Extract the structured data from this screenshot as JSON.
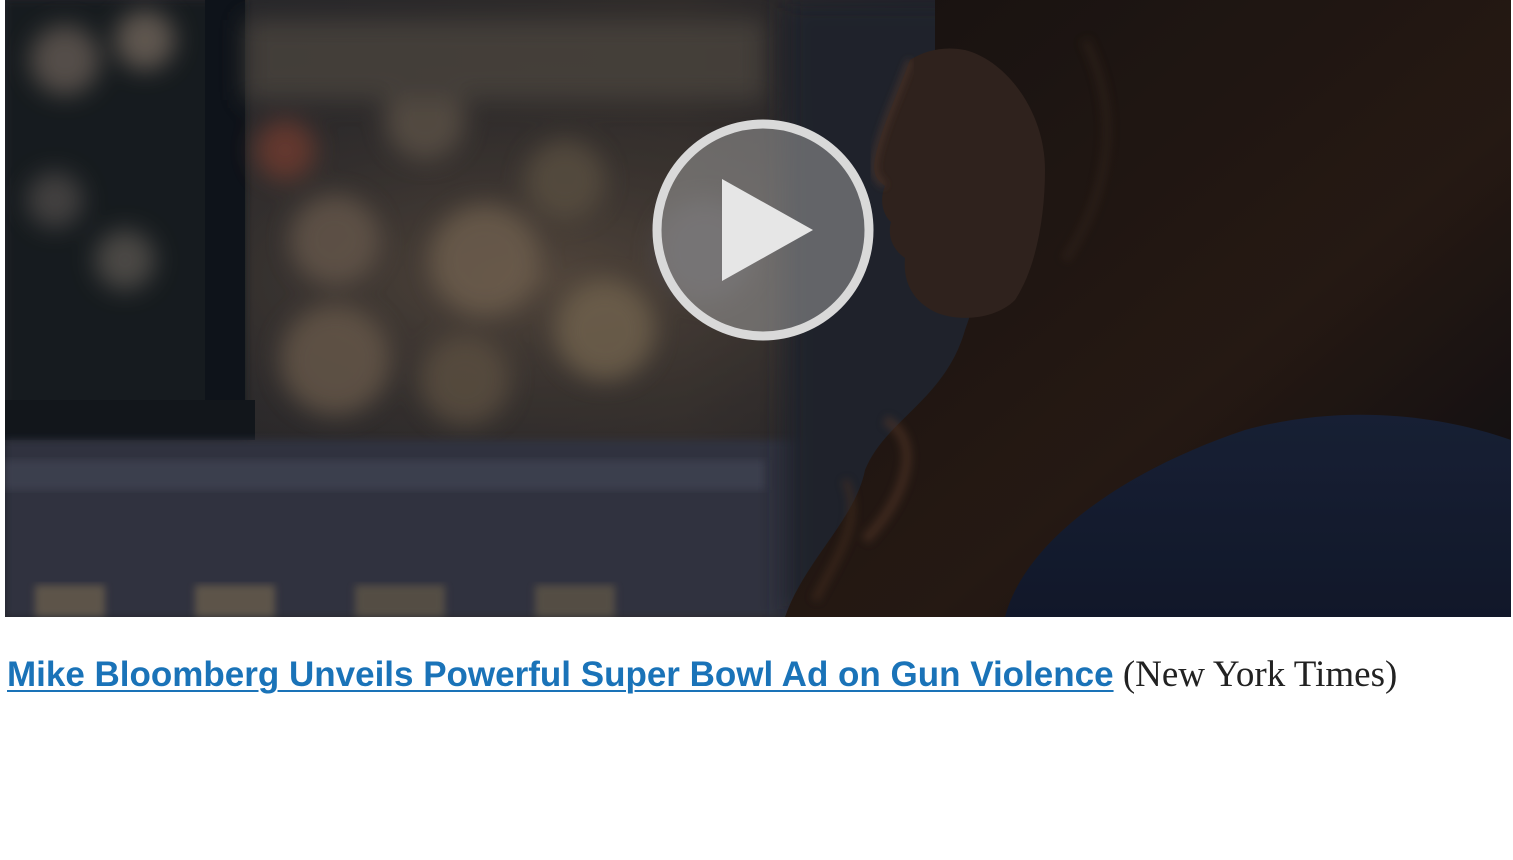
{
  "video": {
    "thumbnail_icon": "video-thumbnail-image",
    "play_icon": "play-icon"
  },
  "article": {
    "headline_link": "Mike Bloomberg Unveils Powerful Super Bowl Ad on Gun Violence",
    "source": " (New York Times)"
  },
  "colors": {
    "link": "#1a73b8",
    "text": "#222222",
    "background": "#ffffff"
  }
}
